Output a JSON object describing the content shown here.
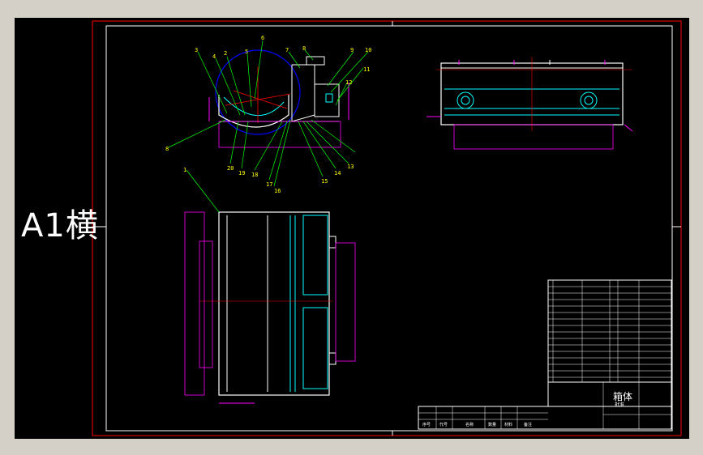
{
  "sheet_label": "A1横",
  "colors": {
    "background": "#000000",
    "frame": "#ff0000",
    "border": "#ffffff",
    "geometry": "#ffffff",
    "dimension": "#ff00ff",
    "centerline": "#ff0000",
    "hidden": "#00ffff",
    "circle": "#0000ff",
    "leader": "#00ff00",
    "title_block": "#ffffff"
  },
  "balloons": {
    "top_left": [
      "3",
      "4",
      "2",
      "5",
      "6",
      "7",
      "8",
      "9",
      "10",
      "11",
      "12"
    ],
    "bottom_left": [
      "8",
      "20",
      "19",
      "18",
      "17",
      "16",
      "15",
      "14",
      "13"
    ],
    "plan": [
      "1"
    ]
  },
  "title_block": {
    "heading": "箱体",
    "approved_label": "批准",
    "row_labels": [
      "序号",
      "代号",
      "名称",
      "数量",
      "材料",
      "备注"
    ]
  }
}
